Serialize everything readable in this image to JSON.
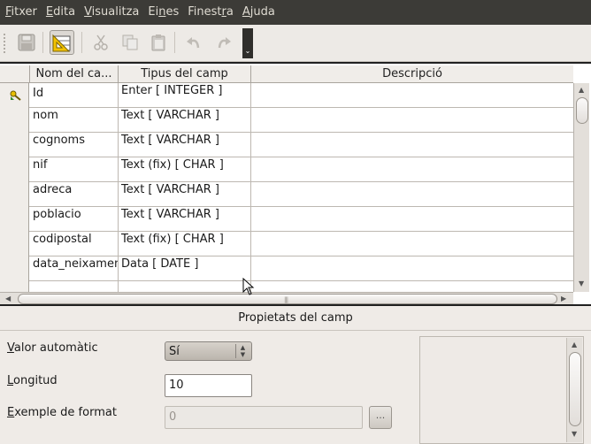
{
  "menu": [
    {
      "accel": "F",
      "rest": "itxer"
    },
    {
      "accel": "E",
      "rest": "dita"
    },
    {
      "accel": "V",
      "rest": "isualitza"
    },
    {
      "pre": "Ei",
      "accel": "n",
      "rest": "es"
    },
    {
      "pre": "Finest",
      "accel": "r",
      "rest": "a"
    },
    {
      "accel": "A",
      "rest": "juda"
    }
  ],
  "toolbar": {
    "icons": [
      "save-icon",
      "table-design-icon",
      "cut-icon",
      "copy-icon",
      "paste-icon",
      "undo-icon",
      "redo-icon"
    ],
    "overflow_glyph": "⌄"
  },
  "table": {
    "headers": [
      "Nom del ca...",
      "Tipus del camp",
      "Descripció"
    ],
    "rows": [
      {
        "name": "Id",
        "type": "Enter [ INTEGER ]",
        "desc": "",
        "primary_key": true
      },
      {
        "name": "nom",
        "type": "Text [ VARCHAR ]",
        "desc": ""
      },
      {
        "name": "cognoms",
        "type": "Text [ VARCHAR ]",
        "desc": ""
      },
      {
        "name": "nif",
        "type": "Text (fix) [ CHAR ]",
        "desc": ""
      },
      {
        "name": "adreca",
        "type": "Text [ VARCHAR ]",
        "desc": ""
      },
      {
        "name": "poblacio",
        "type": "Text [ VARCHAR ]",
        "desc": ""
      },
      {
        "name": "codipostal",
        "type": "Text (fix) [ CHAR ]",
        "desc": ""
      },
      {
        "name": "data_neixament",
        "type": "Data [ DATE ]",
        "desc": ""
      },
      {
        "name": "",
        "type": "",
        "desc": ""
      }
    ]
  },
  "properties": {
    "title": "Propietats del camp",
    "auto_value": {
      "label_accel": "V",
      "label_rest": "alor automàtic",
      "value": "Sí"
    },
    "length": {
      "label_accel": "L",
      "label_rest": "ongitud",
      "value": "10"
    },
    "format_example": {
      "label_accel": "E",
      "label_rest": "xemple de format",
      "value": "0",
      "button": "..."
    }
  },
  "colors": {
    "menubar_bg": "#3c3b37",
    "menubar_text": "#dfdbd2",
    "window_bg": "#efebe7"
  }
}
